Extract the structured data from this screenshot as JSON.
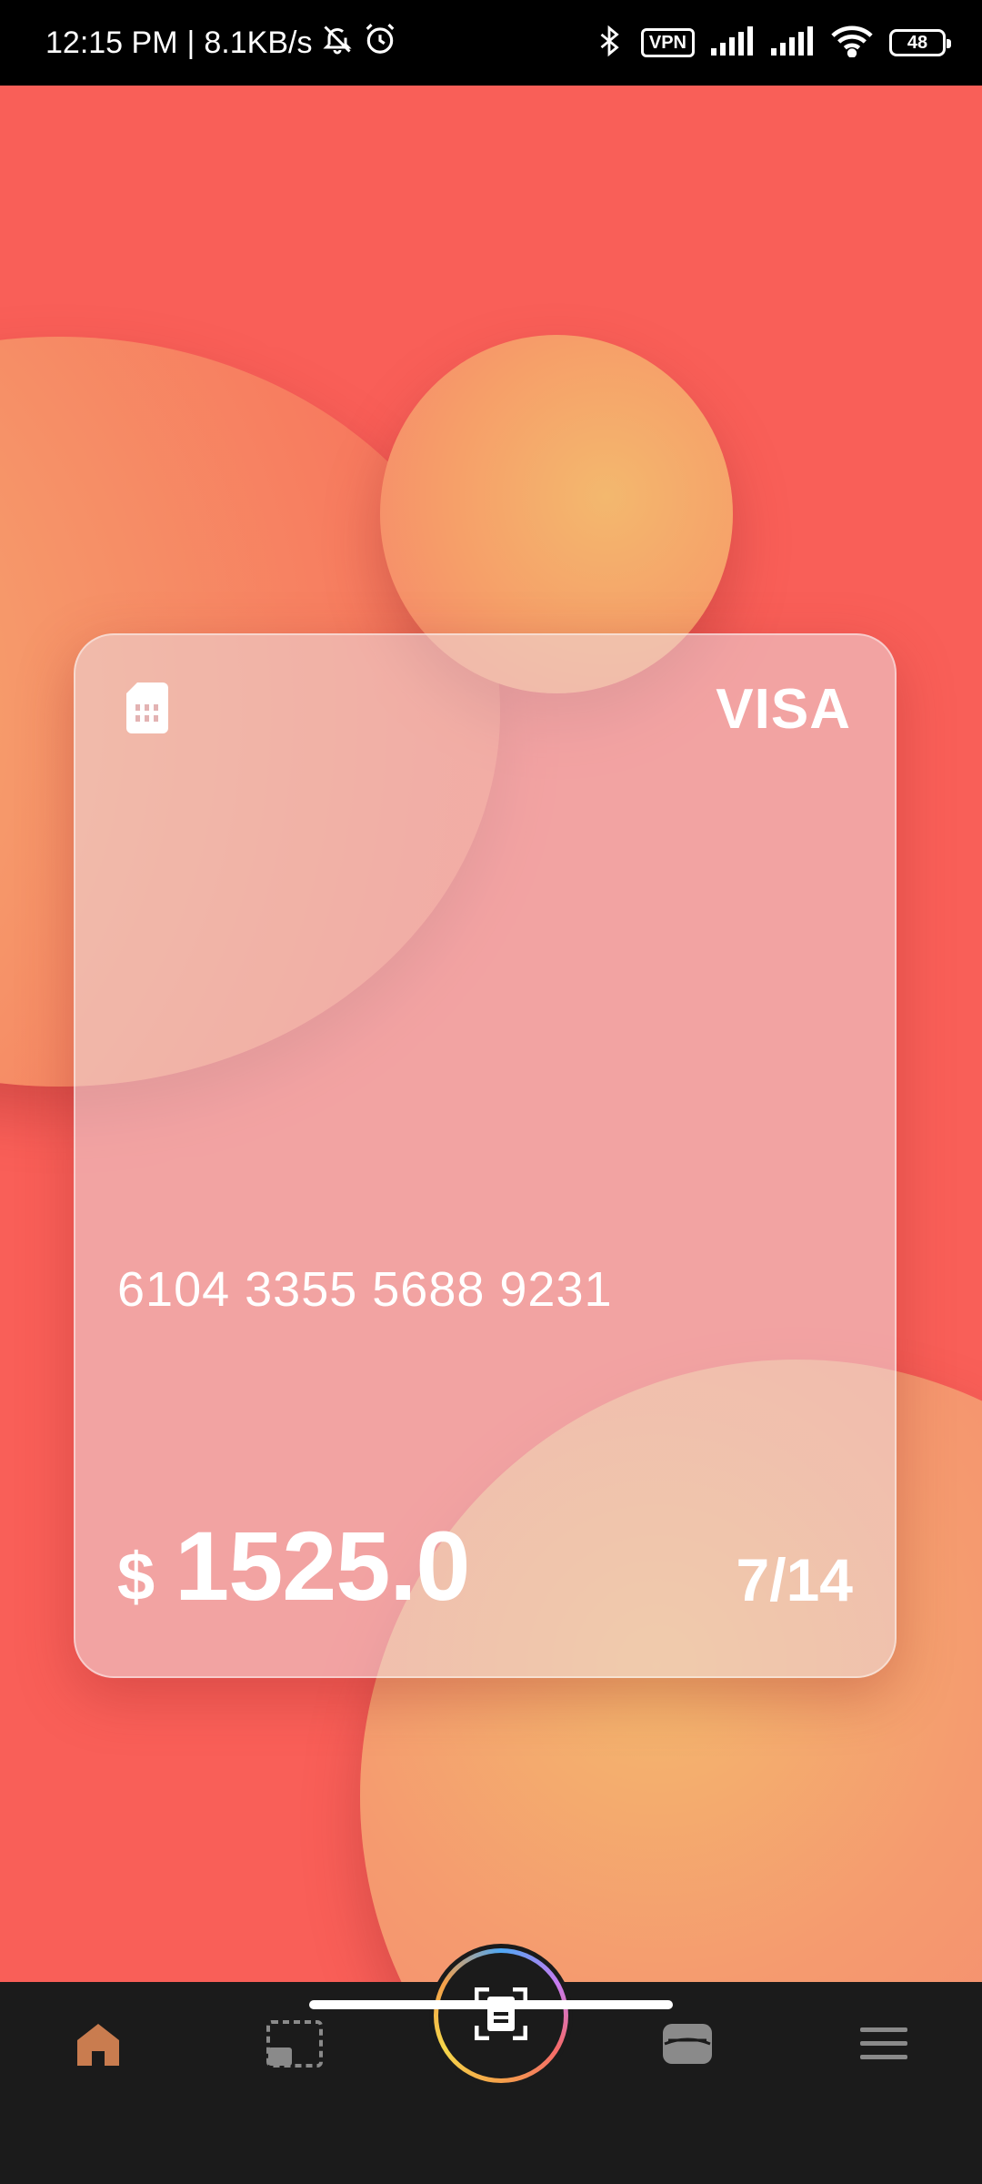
{
  "status_bar": {
    "time": "12:15 PM",
    "separator": "|",
    "network_speed": "8.1KB/s",
    "vpn_label": "VPN",
    "battery_level": "48",
    "icons": [
      "bell-muted-icon",
      "alarm-icon",
      "bluetooth-icon",
      "vpn-icon",
      "signal-icon",
      "signal-icon",
      "wifi-icon",
      "battery-icon"
    ]
  },
  "card": {
    "brand": "VISA",
    "number": "6104 3355 5688 9231",
    "currency_symbol": "$",
    "balance": "1525.0",
    "expiry": "7/14",
    "chip_icon": "sim-card-icon"
  },
  "bottom_nav": {
    "items": [
      {
        "icon": "home-icon",
        "active": true
      },
      {
        "icon": "gallery-icon",
        "active": false
      },
      {
        "icon": "scan-document-icon",
        "active": false
      },
      {
        "icon": "wallet-icon",
        "active": false
      },
      {
        "icon": "menu-icon",
        "active": false
      }
    ]
  },
  "colors": {
    "background": "#f95f58",
    "accent_orange": "#f3b86e",
    "nav_background": "#1b1b1b",
    "home_active": "#c97c4f"
  }
}
